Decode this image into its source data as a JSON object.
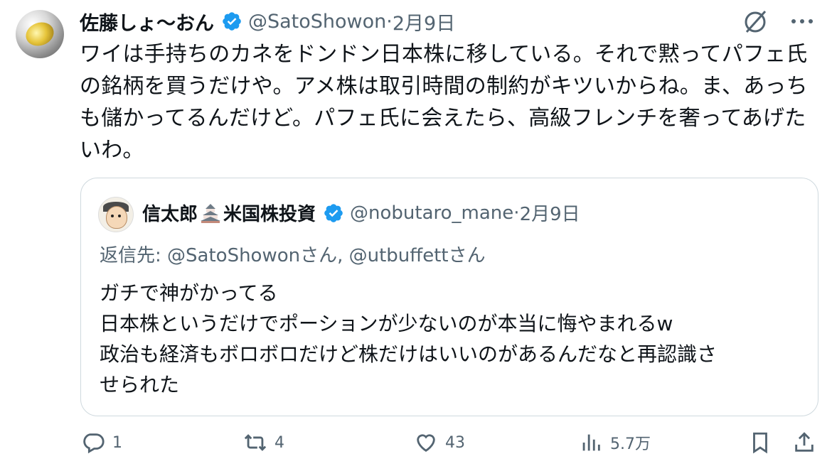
{
  "author": {
    "display_name": "佐藤しょ〜おん",
    "handle": "@SatoShowon",
    "separator": " · ",
    "date": "2月9日"
  },
  "tweet": {
    "text": "ワイは手持ちのカネをドンドン日本株に移している。それで黙ってパフェ氏の銘柄を買うだけや。アメ株は取引時間の制約がキツいからね。ま、あっちも儲かってるんだけど。パフェ氏に会えたら、高級フレンチを奢ってあげたいわ。"
  },
  "quote": {
    "display_name_1": "信太郎",
    "display_name_2": "米国株投資",
    "handle": "@nobutaro_mane",
    "separator": " · ",
    "date": "2月9日",
    "reply_to": "返信先: @SatoShowonさん, @utbuffettさん",
    "lines": [
      "ガチで神がかってる",
      "日本株というだけでポーションが少ないのが本当に悔やまれるw",
      "政治も経済もボロボロだけど株だけはいいのがあるんだなと再認識さ",
      "せられた"
    ]
  },
  "actions": {
    "reply_count": "1",
    "repost_count": "4",
    "like_count": "43",
    "view_count": "5.7万"
  },
  "colors": {
    "verified": "#1d9bf0",
    "muted": "#536471",
    "border": "#cfd9de"
  },
  "icons": [
    "verified-badge-icon",
    "grok-icon",
    "more-icon",
    "castle-icon",
    "reply-icon",
    "repost-icon",
    "like-icon",
    "views-icon",
    "bookmark-icon",
    "share-icon"
  ]
}
